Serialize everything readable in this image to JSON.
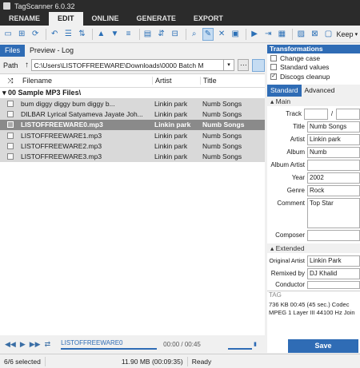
{
  "window": {
    "title": "TagScanner 6.0.32"
  },
  "menu": {
    "tabs": [
      "RENAME",
      "EDIT",
      "ONLINE",
      "GENERATE",
      "EXPORT"
    ],
    "active": "EDIT"
  },
  "toolbar": {
    "keep_label": "Keep"
  },
  "left": {
    "tabs": [
      "Files",
      "Preview - Log"
    ],
    "path_label": "Path",
    "path_value": "C:\\Users\\LISTOFFREEWARE\\Downloads\\0000 Batch M",
    "columns": [
      "Filename",
      "Artist",
      "Title"
    ],
    "group": "00 Sample MP3 Files\\",
    "rows": [
      {
        "filename": "bum diggy diggy bum diggy b...",
        "artist": "Linkin park",
        "title": "Numb Songs",
        "selected": false
      },
      {
        "filename": "DILBAR Lyrical  Satyameva Jayate  Joh...",
        "artist": "Linkin park",
        "title": "Numb Songs",
        "selected": false
      },
      {
        "filename": "LISTOFFREEWARE0.mp3",
        "artist": "Linkin park",
        "title": "Numb Songs",
        "selected": true
      },
      {
        "filename": "LISTOFFREEWARE1.mp3",
        "artist": "Linkin park",
        "title": "Numb Songs",
        "selected": false
      },
      {
        "filename": "LISTOFFREEWARE2.mp3",
        "artist": "Linkin park",
        "title": "Numb Songs",
        "selected": false
      },
      {
        "filename": "LISTOFFREEWARE3.mp3",
        "artist": "Linkin park",
        "title": "Numb Songs",
        "selected": false
      }
    ]
  },
  "player": {
    "track": "LISTOFFREEWARE0",
    "time": "00:00 / 00:45"
  },
  "right": {
    "transformations_title": "Transformations",
    "options": [
      {
        "label": "Change case",
        "checked": false
      },
      {
        "label": "Standard values",
        "checked": false
      },
      {
        "label": "Discogs cleanup",
        "checked": true
      }
    ],
    "tabs": [
      "Standard",
      "Advanced"
    ],
    "main_section": "Main",
    "fields": {
      "track_label": "Track",
      "title_label": "Title",
      "title_value": "Numb Songs",
      "artist_label": "Artist",
      "artist_value": "Linkin park",
      "album_label": "Album",
      "album_value": "Numb",
      "album_artist_label": "Album Artist",
      "album_artist_value": "",
      "year_label": "Year",
      "year_value": "2002",
      "genre_label": "Genre",
      "genre_value": "Rock",
      "comment_label": "Comment",
      "comment_value": "Top Star",
      "composer_label": "Composer",
      "composer_value": ""
    },
    "extended_section": "Extended",
    "extended": {
      "orig_artist_label": "Original Artist",
      "orig_artist_value": "Linkin Park",
      "remixed_label": "Remixed by",
      "remixed_value": "DJ Khalid",
      "conductor_label": "Conductor",
      "conductor_value": ""
    },
    "tag_label": "TAG",
    "info_line1": "736 KB  00:45 (45 sec.)  Codec",
    "info_line2": "MPEG 1 Layer III  44100 Hz  Join",
    "save_label": "Save"
  },
  "status": {
    "selected": "6/6 selected",
    "size": "11.90 MB (00:09:35)",
    "state": "Ready"
  }
}
